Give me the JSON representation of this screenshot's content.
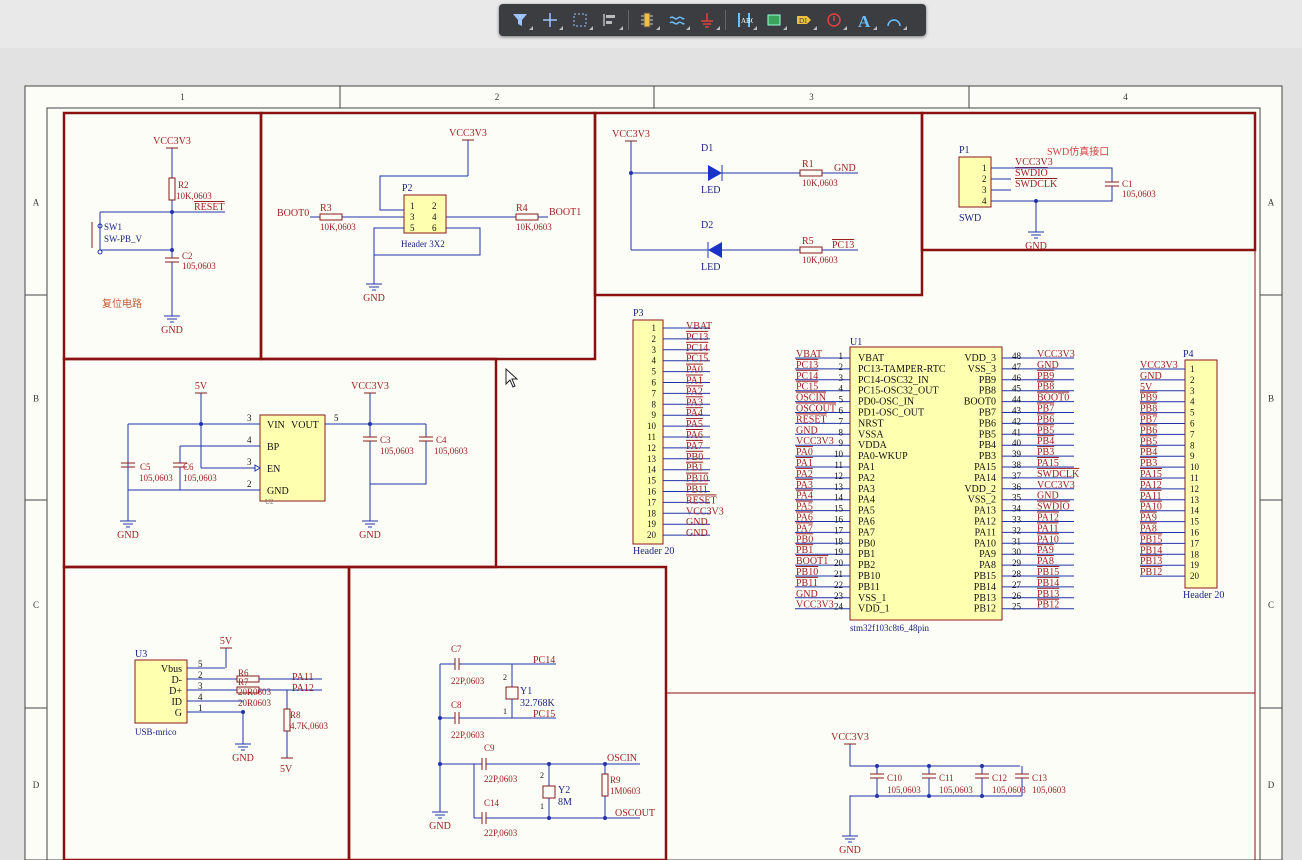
{
  "toolbar": {
    "tools": [
      "filter-icon",
      "crosshair-icon",
      "select-rect-icon",
      "align-icon",
      "component-icon",
      "wire-icon",
      "ground-icon",
      "bus-icon",
      "net-label-icon",
      "port-icon",
      "power-port-icon",
      "text-icon",
      "arc-icon"
    ],
    "text_tool_glyph": "A"
  },
  "border": {
    "columns": [
      "1",
      "2",
      "3",
      "4"
    ],
    "rows": [
      "A",
      "B",
      "C",
      "D"
    ]
  },
  "colors": {
    "wire": "#2233aa",
    "part": "#8b1a1a",
    "frame": "#8b1010",
    "body": "#ffffb0",
    "text_red": "#9c2020",
    "text_blue": "#1a237e"
  },
  "reset_block": {
    "vcc": "VCC3V3",
    "r_ref": "R2",
    "r_val": "10K,0603",
    "net": "RESET",
    "sw_ref": "SW1",
    "sw_val": "SW-PB_V",
    "c_ref": "C2",
    "c_val": "105,0603",
    "gnd": "GND",
    "caption": "复位电路"
  },
  "boot_block": {
    "vcc": "VCC3V3",
    "left_net": "BOOT0",
    "r3_ref": "R3",
    "r3_val": "10K,0603",
    "hdr_ref": "P2",
    "hdr_val": "Header 3X2",
    "pins_left": [
      "1",
      "3",
      "5"
    ],
    "pins_right": [
      "2",
      "4",
      "6"
    ],
    "r4_ref": "R4",
    "r4_val": "10K,0603",
    "right_net": "BOOT1",
    "gnd": "GND"
  },
  "led_block": {
    "vcc": "VCC3V3",
    "d1": "D1",
    "d2": "D2",
    "led": "LED",
    "r1_ref": "R1",
    "r1_val": "10K,0603",
    "r1_net": "GND",
    "r5_ref": "R5",
    "r5_val": "10K,0603",
    "r5_net": "PC13"
  },
  "swd_block": {
    "title": "SWD仿真接口",
    "ref": "P1",
    "name": "SWD",
    "pins": [
      "1",
      "2",
      "3",
      "4"
    ],
    "nets": [
      "VCC3V3",
      "SWDIO",
      "SWDCLK"
    ],
    "c_ref": "C1",
    "c_val": "105,0603",
    "gnd": "GND"
  },
  "p3": {
    "ref": "P3",
    "name": "Header 20",
    "pins": [
      "1",
      "2",
      "3",
      "4",
      "5",
      "6",
      "7",
      "8",
      "9",
      "10",
      "11",
      "12",
      "13",
      "14",
      "15",
      "16",
      "17",
      "18",
      "19",
      "20"
    ],
    "nets": [
      "VBAT",
      "PC13",
      "PC14",
      "PC15",
      "PA0",
      "PA1",
      "PA2",
      "PA3",
      "PA4",
      "PA5",
      "PA6",
      "PA7",
      "PB0",
      "PB1",
      "PB10",
      "PB11",
      "RESET",
      "VCC3V3",
      "GND",
      "GND"
    ]
  },
  "u1": {
    "ref": "U1",
    "name": "stm32f103c8t6_48pin",
    "left_pins": [
      "1",
      "2",
      "3",
      "4",
      "5",
      "6",
      "7",
      "8",
      "9",
      "10",
      "11",
      "12",
      "13",
      "14",
      "15",
      "16",
      "17",
      "18",
      "19",
      "20",
      "21",
      "22",
      "23",
      "24"
    ],
    "left_names": [
      "VBAT",
      "PC13-TAMPER-RTC",
      "PC14-OSC32_IN",
      "PC15-OSC32_OUT",
      "PD0-OSC_IN",
      "PD1-OSC_OUT",
      "NRST",
      "VSSA",
      "VDDA",
      "PA0-WKUP",
      "PA1",
      "PA2",
      "PA3",
      "PA4",
      "PA5",
      "PA6",
      "PA7",
      "PB0",
      "PB1",
      "PB2",
      "PB10",
      "PB11",
      "VSS_1",
      "VDD_1"
    ],
    "left_nets": [
      "VBAT",
      "PC13",
      "PC14",
      "PC15",
      "OSCIN",
      "OSCOUT",
      "RESET",
      "GND",
      "VCC3V3",
      "PA0",
      "PA1",
      "PA2",
      "PA3",
      "PA4",
      "PA5",
      "PA6",
      "PA7",
      "PB0",
      "PB1",
      "BOOT1",
      "PB10",
      "PB11",
      "GND",
      "VCC3V3"
    ],
    "right_pins": [
      "48",
      "47",
      "46",
      "45",
      "44",
      "43",
      "42",
      "41",
      "40",
      "39",
      "38",
      "37",
      "36",
      "35",
      "34",
      "33",
      "32",
      "31",
      "30",
      "29",
      "28",
      "27",
      "26",
      "25"
    ],
    "right_names": [
      "VDD_3",
      "VSS_3",
      "PB9",
      "PB8",
      "BOOT0",
      "PB7",
      "PB6",
      "PB5",
      "PB4",
      "PB3",
      "PA15",
      "PA14",
      "VDD_2",
      "VSS_2",
      "PA13",
      "PA12",
      "PA11",
      "PA10",
      "PA9",
      "PA8",
      "PB15",
      "PB14",
      "PB13",
      "PB12"
    ],
    "right_nets": [
      "VCC3V3",
      "GND",
      "PB9",
      "PB8",
      "BOOT0",
      "PB7",
      "PB6",
      "PB5",
      "PB4",
      "PB3",
      "PA15",
      "SWDCLK",
      "VCC3V3",
      "GND",
      "SWDIO",
      "PA12",
      "PA11",
      "PA10",
      "PA9",
      "PA8",
      "PB15",
      "PB14",
      "PB13",
      "PB12"
    ]
  },
  "p4": {
    "ref": "P4",
    "name": "Header 20",
    "pins": [
      "1",
      "2",
      "3",
      "4",
      "5",
      "6",
      "7",
      "8",
      "9",
      "10",
      "11",
      "12",
      "13",
      "14",
      "15",
      "16",
      "17",
      "18",
      "19",
      "20"
    ],
    "nets": [
      "VCC3V3",
      "GND",
      "5V",
      "PB9",
      "PB8",
      "PB7",
      "PB6",
      "PB5",
      "PB4",
      "PB3",
      "PA15",
      "PA12",
      "PA11",
      "PA10",
      "PA9",
      "PA8",
      "PB15",
      "PB14",
      "PB13",
      "PB12"
    ]
  },
  "power_block": {
    "in": "5V",
    "out": "VCC3V3",
    "u_ref": "U2",
    "pin_names": [
      "VIN",
      "VOUT",
      "BP",
      "EN",
      "GND"
    ],
    "pin_nums": [
      "3",
      "5",
      "4",
      "3",
      "2"
    ],
    "c5": "C5",
    "c5v": "105,0603",
    "c6": "C6",
    "c6v": "105,0603",
    "c3": "C3",
    "c3v": "105,0603",
    "c4": "C4",
    "c4v": "105,0603",
    "gnd": "GND"
  },
  "usb_block": {
    "ref": "U3",
    "name": "USB-mrico",
    "pins": [
      "Vbus",
      "D-",
      "D+",
      "ID",
      "G"
    ],
    "pin_nums": [
      "5",
      "2",
      "3",
      "4",
      "1"
    ],
    "r6": "R6",
    "r7": "R7",
    "r7v": "20R0603",
    "r6v": "20R0603",
    "net_a11": "PA11",
    "net_a12": "PA12",
    "r8": "R8",
    "r8v": "4.7K,0603",
    "v5": "5V",
    "gnd": "GND"
  },
  "osc_block": {
    "c7": "C7",
    "c7v": "22P,0603",
    "c8": "C8",
    "c8v": "22P,0603",
    "y1": "Y1",
    "y1v": "32.768K",
    "pc14": "PC14",
    "pc15": "PC15",
    "c9": "C9",
    "c9v": "22P,0603",
    "c14": "C14",
    "c14v": "22P,0603",
    "y2": "Y2",
    "y2v": "8M",
    "r9": "R9",
    "r9v": "1M0603",
    "oscin": "OSCIN",
    "oscout": "OSCOUT",
    "gnd": "GND",
    "pin1": "1",
    "pin2": "2"
  },
  "decoupling_block": {
    "vcc": "VCC3V3",
    "caps": [
      "C10",
      "C11",
      "C12",
      "C13"
    ],
    "val": "105,0603",
    "gnd": "GND"
  }
}
